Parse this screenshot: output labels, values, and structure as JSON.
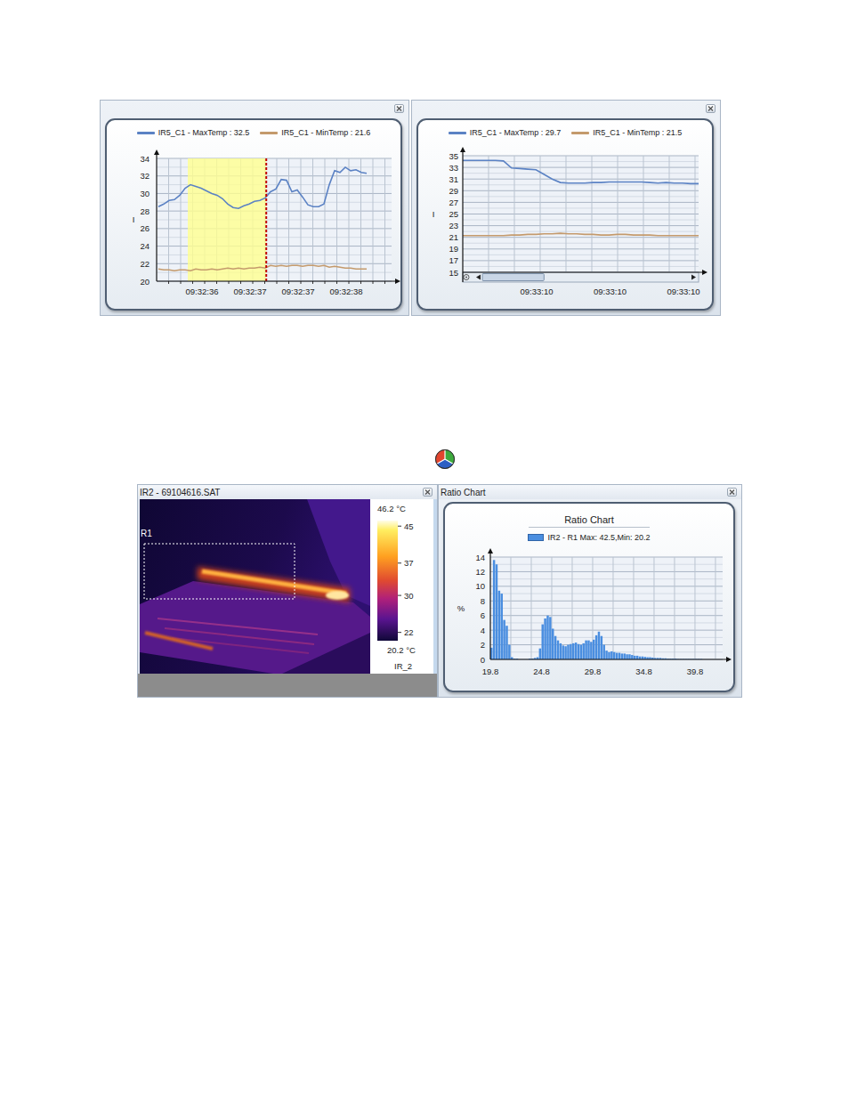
{
  "trend_windows": [
    {
      "series": [
        {
          "label": "IR5_C1 - MaxTemp : 32.5",
          "color": "#5b82c4",
          "values": [
            28.5,
            28.8,
            29.2,
            29.3,
            29.8,
            30.6,
            31.0,
            30.8,
            30.6,
            30.3,
            30.0,
            29.8,
            29.4,
            28.8,
            28.4,
            28.3,
            28.6,
            28.8,
            29.1,
            29.2,
            29.5,
            30.2,
            30.5,
            31.6,
            31.5,
            30.2,
            30.4,
            29.6,
            28.7,
            28.5,
            28.5,
            28.8,
            31.0,
            32.6,
            32.4,
            33.0,
            32.6,
            32.7,
            32.4,
            32.3
          ]
        },
        {
          "label": "IR5_C1 - MinTemp : 21.6",
          "color": "#c49a6c",
          "values": [
            21.4,
            21.3,
            21.3,
            21.2,
            21.3,
            21.3,
            21.2,
            21.4,
            21.3,
            21.3,
            21.4,
            21.3,
            21.4,
            21.5,
            21.4,
            21.5,
            21.4,
            21.5,
            21.5,
            21.6,
            21.5,
            21.8,
            21.7,
            21.8,
            21.7,
            21.8,
            21.8,
            21.7,
            21.8,
            21.8,
            21.7,
            21.8,
            21.6,
            21.7,
            21.6,
            21.5,
            21.5,
            21.4,
            21.4,
            21.4
          ]
        }
      ],
      "y_axis_label": "I",
      "y_ticks": [
        "34",
        "32",
        "30",
        "28",
        "26",
        "24",
        "22",
        "20"
      ],
      "x_ticks": [
        "09:32:36",
        "09:32:37",
        "09:32:37",
        "09:32:38"
      ],
      "selection": {
        "start": 5.5,
        "end": 20.2
      },
      "cursor": 20.2
    },
    {
      "series": [
        {
          "label": "IR5_C1 - MaxTemp : 29.7",
          "color": "#5b82c4",
          "values": [
            34.2,
            34.2,
            34.2,
            34.2,
            34.2,
            34.1,
            32.9,
            32.8,
            32.7,
            32.6,
            31.8,
            31.0,
            30.4,
            30.3,
            30.3,
            30.3,
            30.4,
            30.4,
            30.5,
            30.5,
            30.5,
            30.5,
            30.5,
            30.4,
            30.3,
            30.4,
            30.3,
            30.3,
            30.2,
            30.2
          ]
        },
        {
          "label": "IR5_C1 - MinTemp : 21.5",
          "color": "#c49a6c",
          "values": [
            21.3,
            21.3,
            21.3,
            21.3,
            21.3,
            21.3,
            21.4,
            21.4,
            21.5,
            21.5,
            21.6,
            21.6,
            21.7,
            21.6,
            21.6,
            21.5,
            21.5,
            21.4,
            21.4,
            21.5,
            21.5,
            21.4,
            21.4,
            21.4,
            21.3,
            21.3,
            21.3,
            21.3,
            21.3,
            21.3
          ]
        }
      ],
      "y_axis_label": "I",
      "y_ticks": [
        "35",
        "33",
        "31",
        "29",
        "27",
        "25",
        "23",
        "21",
        "19",
        "17",
        "15"
      ],
      "x_ticks": [
        "09:33:10",
        "09:33:10",
        "09:33:10"
      ],
      "scrollbar": {
        "position": 0,
        "level": 0.3
      }
    }
  ],
  "thermal_window": {
    "title": "IR2 - 69104616.SAT",
    "region_label": "R1",
    "scale": {
      "max": "46.2 °C",
      "min": "20.2 °C",
      "ticks": [
        "45",
        "37",
        "30",
        "22"
      ],
      "name": "IR_2"
    }
  },
  "ratio_window": {
    "title": "Ratio Chart",
    "chart_title": "Ratio Chart",
    "legend": {
      "label": "IR2 - R1 Max: 42.5,Min: 20.2",
      "color": "#4a8ee0"
    },
    "y_axis_label": "%",
    "y_ticks": [
      "14",
      "12",
      "10",
      "8",
      "6",
      "4",
      "2",
      "0"
    ],
    "x_ticks": [
      "19.8",
      "24.8",
      "29.8",
      "34.8",
      "39.8"
    ],
    "x_min": 19.8,
    "x_max": 42.5,
    "bin_width": 0.25,
    "values": [
      1.6,
      13.6,
      13.0,
      9.4,
      9.0,
      5.4,
      4.6,
      2.0,
      0.3,
      0.1,
      0.1,
      0,
      0,
      0,
      0,
      0.1,
      0.1,
      0.2,
      0.3,
      1.5,
      4.8,
      5.6,
      6.0,
      5.8,
      4.2,
      3.2,
      2.6,
      2.2,
      1.9,
      1.8,
      2.0,
      2.1,
      2.2,
      2.3,
      2.1,
      2.0,
      2.2,
      2.6,
      2.6,
      2.4,
      2.7,
      3.3,
      3.8,
      3.2,
      2.0,
      1.2,
      1.0,
      1.1,
      1.0,
      0.9,
      0.9,
      0.8,
      0.8,
      0.7,
      0.7,
      0.6,
      0.5,
      0.5,
      0.4,
      0.4,
      0.35,
      0.3,
      0.3,
      0.25,
      0.2,
      0.2,
      0.2,
      0.15,
      0.15,
      0.1,
      0.1,
      0.1,
      0.1,
      0.05,
      0.05,
      0.05,
      0.05,
      0.05,
      0.05,
      0.05,
      0.05,
      0.05,
      0.05,
      0,
      0,
      0,
      0,
      0,
      0,
      0
    ]
  }
}
